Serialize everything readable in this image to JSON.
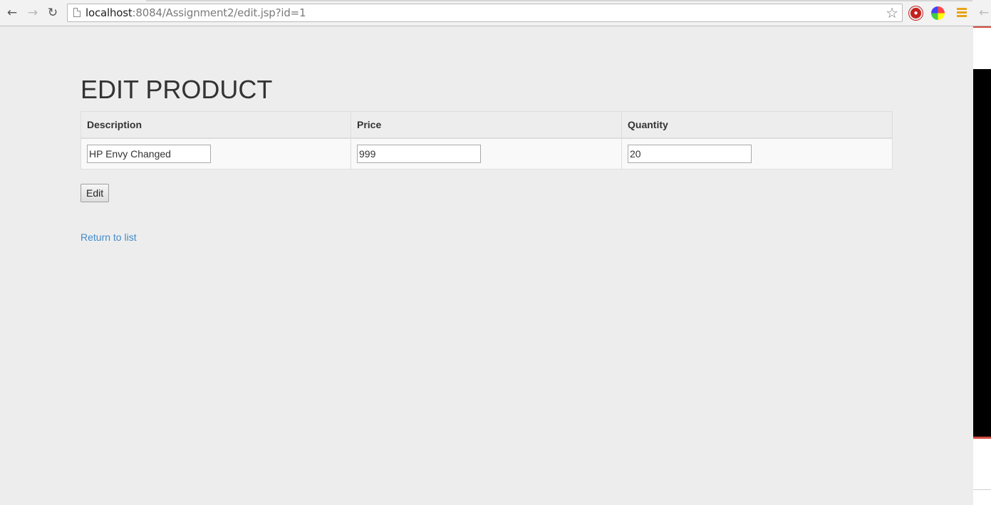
{
  "browser": {
    "url_host": "localhost",
    "url_rest": ":8084/Assignment2/edit.jsp?id=1",
    "back_icon": "back-arrow-icon",
    "forward_icon": "forward-arrow-icon",
    "reload_icon": "reload-icon",
    "star_icon": "bookmark-star-icon"
  },
  "page": {
    "title": "EDIT PRODUCT",
    "table": {
      "headers": [
        "Description",
        "Price",
        "Quantity"
      ],
      "values": {
        "description": "HP Envy Changed",
        "price": "999",
        "quantity": "20"
      }
    },
    "edit_button": "Edit",
    "return_link": "Return to list"
  },
  "colors": {
    "background": "#ededed",
    "link": "#428bca",
    "accent_red": "#d24b3d"
  }
}
